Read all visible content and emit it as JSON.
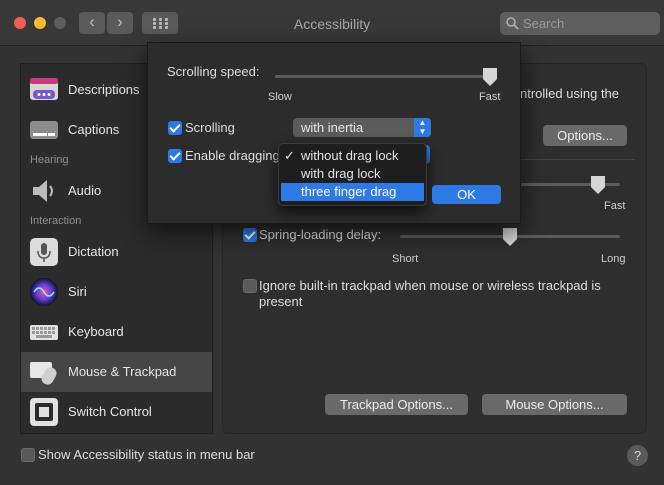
{
  "window": {
    "title": "Accessibility"
  },
  "search": {
    "placeholder": "Search"
  },
  "nav": {
    "back": "‹",
    "forward": "›"
  },
  "colors": {
    "accent": "#2d79e6",
    "close": "#ec5f57",
    "minimize": "#f5bd2f",
    "zoom_inactive": "#5e5e5e"
  },
  "sidebar": {
    "items": [
      {
        "label": "Descriptions",
        "icon": "descriptions-icon"
      },
      {
        "label": "Captions",
        "icon": "captions-icon"
      },
      {
        "section": "Hearing"
      },
      {
        "label": "Audio",
        "icon": "speaker-icon"
      },
      {
        "section": "Interaction"
      },
      {
        "label": "Dictation",
        "icon": "microphone-icon"
      },
      {
        "label": "Siri",
        "icon": "siri-icon"
      },
      {
        "label": "Keyboard",
        "icon": "keyboard-icon"
      },
      {
        "label": "Mouse & Trackpad",
        "icon": "mouse-trackpad-icon",
        "selected": true
      },
      {
        "label": "Switch Control",
        "icon": "switch-control-icon"
      }
    ]
  },
  "main": {
    "partial_text": "ntrolled using the",
    "options_button": "Options...",
    "double_click_slider": {
      "max_label": "Fast",
      "value": 0.78
    },
    "spring_loading": {
      "label": "Spring-loading delay:",
      "checked": true,
      "min_label": "Short",
      "max_label": "Long",
      "value": 0.5
    },
    "ignore_trackpad": {
      "label": "Ignore built-in trackpad when mouse or wireless trackpad is present",
      "checked": false
    },
    "trackpad_options_button": "Trackpad Options...",
    "mouse_options_button": "Mouse Options..."
  },
  "sheet": {
    "scrolling_speed": {
      "label": "Scrolling speed:",
      "min_label": "Slow",
      "max_label": "Fast",
      "value": 1.0
    },
    "scrolling": {
      "label": "Scrolling",
      "checked": true,
      "value": "with inertia"
    },
    "enable_dragging": {
      "label": "Enable dragging",
      "checked": true
    },
    "drag_options": [
      {
        "label": "without drag lock",
        "checked": true,
        "highlighted": false
      },
      {
        "label": "with drag lock",
        "checked": false,
        "highlighted": false
      },
      {
        "label": "three finger drag",
        "checked": false,
        "highlighted": true
      }
    ],
    "ok_button": "OK"
  },
  "footer": {
    "show_status_label": "Show Accessibility status in menu bar",
    "show_status_checked": false,
    "help": "?"
  }
}
